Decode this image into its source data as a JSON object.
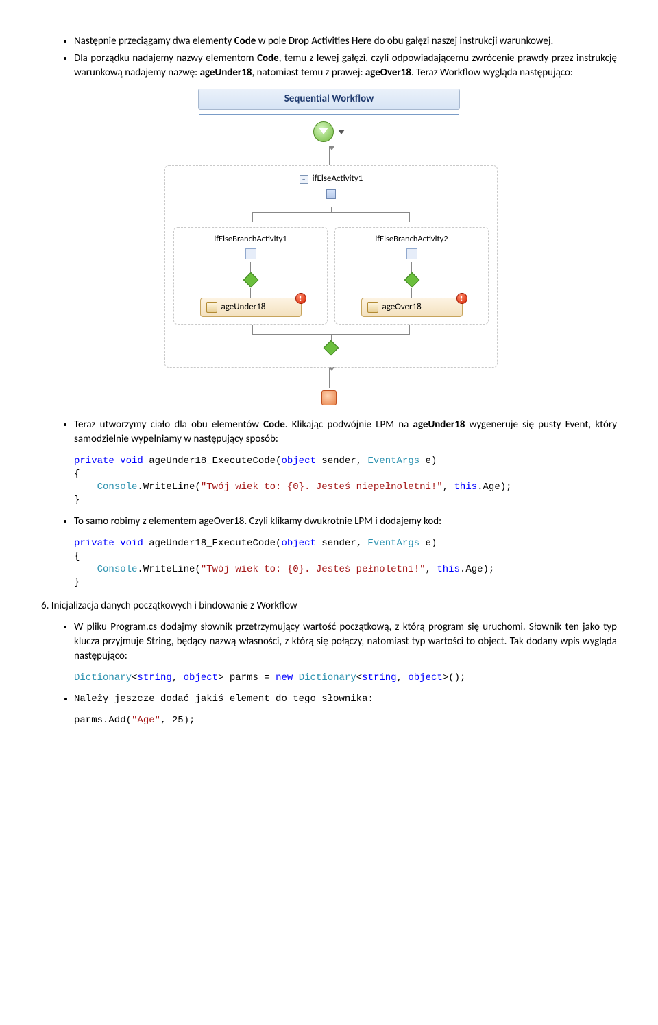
{
  "para1_pre": "Następnie przeciągamy dwa elementy ",
  "para1_bold": "Code",
  "para1_post": " w pole Drop Activities Here do obu gałęzi naszej instrukcji warunkowej.",
  "para2_a": "Dla porządku nadajemy nazwy elementom ",
  "para2_b1": "Code",
  "para2_c": ", temu z lewej gałęzi, czyli odpowiadającemu zwrócenie prawdy przez instrukcję warunkową nadajemy nazwę: ",
  "para2_b2": "ageUnder18",
  "para2_d": ", natomiast temu z prawej: ",
  "para2_b3": "ageOver18",
  "para2_e": ". Teraz Workflow wygląda następująco:",
  "diagram": {
    "title": "Sequential Workflow",
    "ifelse": "ifElseActivity1",
    "branch1": "ifElseBranchActivity1",
    "branch2": "ifElseBranchActivity2",
    "act1": "ageUnder18",
    "act2": "ageOver18"
  },
  "para3_a": "Teraz utworzymy ciało dla obu elementów ",
  "para3_b1": "Code",
  "para3_c": ". Klikając podwójnie LPM na ",
  "para3_b2": "ageUnder18",
  "para3_d": " wygeneruje się pusty Event, który samodzielnie wypełniamy w następujący sposób:",
  "code1": {
    "kw_private": "private",
    "kw_void": "void",
    "name": " ageUnder18_ExecuteCode(",
    "kw_object": "object",
    "mid": " sender, ",
    "tp_eventargs": "EventArgs",
    "end": " e)",
    "open": "{",
    "call_a": "    ",
    "tp_console": "Console",
    "call_b": ".WriteLine(",
    "str": "\"Twój wiek to: {0}. Jesteś niepełnoletni!\"",
    "call_c": ", ",
    "kw_this": "this",
    "call_d": ".Age);",
    "close": "}"
  },
  "para4": "To samo robimy z elementem ageOver18. Czyli klikamy dwukrotnie LPM i dodajemy kod:",
  "code2": {
    "kw_private": "private",
    "kw_void": "void",
    "name": " ageUnder18_ExecuteCode(",
    "kw_object": "object",
    "mid": " sender, ",
    "tp_eventargs": "EventArgs",
    "end": " e)",
    "open": "{",
    "call_a": "    ",
    "tp_console": "Console",
    "call_b": ".WriteLine(",
    "str": "\"Twój wiek to: {0}. Jesteś pełnoletni!\"",
    "call_c": ", ",
    "kw_this": "this",
    "call_d": ".Age);",
    "close": "}"
  },
  "section6": "6. Inicjalizacja danych początkowych i bindowanie z Workflow",
  "para5": "W pliku Program.cs dodajmy słownik przetrzymujący wartość początkową, z którą program się uruchomi. Słownik ten jako typ klucza przyjmuje String, będący nazwą własności, z którą się połączy, natomiast typ wartości to object. Tak dodany wpis wygląda następująco:",
  "code3": {
    "tp_dict1": "Dictionary",
    "a": "<",
    "kw_string1": "string",
    "b": ", ",
    "kw_object1": "object",
    "c": "> parms = ",
    "kw_new": "new",
    "d": " ",
    "tp_dict2": "Dictionary",
    "e": "<",
    "kw_string2": "string",
    "f": ", ",
    "kw_object2": "object",
    "g": ">();"
  },
  "para6": "Należy jeszcze dodać jakiś element do tego słownika:",
  "code4_a": "parms.Add(",
  "code4_str": "\"Age\"",
  "code4_b": ", 25);"
}
